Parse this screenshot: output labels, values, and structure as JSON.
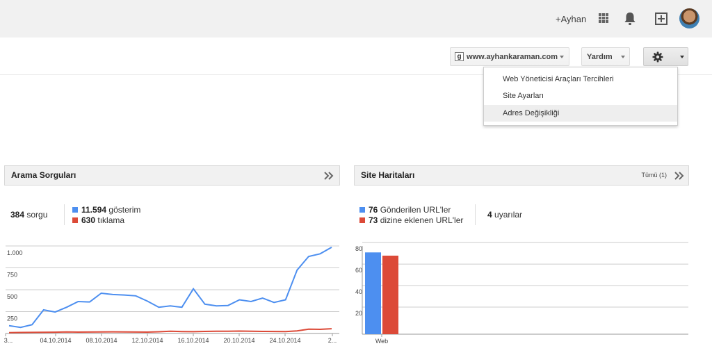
{
  "topbar": {
    "user_name": "+Ayhan"
  },
  "subbar": {
    "site_selector": "www.ayhankaraman.com",
    "site_icon_letter": "g",
    "help_label": "Yardım"
  },
  "settings_menu": {
    "items": [
      {
        "label": "Web Yöneticisi Araçları Tercihleri"
      },
      {
        "label": "Site Ayarları"
      },
      {
        "label": "Adres Değişikliği"
      }
    ]
  },
  "search_queries": {
    "title": "Arama Sorguları",
    "queries_count": "384",
    "queries_label": "sorgu",
    "impressions_count": "11.594",
    "impressions_label": "gösterim",
    "clicks_count": "630",
    "clicks_label": "tıklama"
  },
  "sitemaps": {
    "title": "Site Haritaları",
    "all_link": "Tümü (1)",
    "submitted_count": "76",
    "submitted_label": "Gönderilen URL'ler",
    "indexed_count": "73",
    "indexed_label": "dizine eklenen URL'ler",
    "warnings_count": "4",
    "warnings_label": "uyarılar"
  },
  "colors": {
    "blue": "#4d8ff0",
    "red": "#dc4a38"
  },
  "chart_data": [
    {
      "type": "line",
      "x_tick_labels": [
        "3...",
        "04.10.2014",
        "08.10.2014",
        "12.10.2014",
        "16.10.2014",
        "20.10.2014",
        "24.10.2014",
        "2..."
      ],
      "y_tick_labels": [
        "1.000",
        "750",
        "500",
        "250"
      ],
      "ylim": [
        0,
        1000
      ],
      "grid": true,
      "series": [
        {
          "name": "gösterim",
          "color": "#4d8ff0",
          "values": [
            90,
            70,
            100,
            270,
            245,
            300,
            365,
            360,
            460,
            445,
            440,
            430,
            370,
            300,
            315,
            300,
            510,
            335,
            315,
            320,
            385,
            365,
            405,
            355,
            385,
            725,
            880,
            910,
            985
          ]
        },
        {
          "name": "tıklama",
          "color": "#dc4a38",
          "values": [
            10,
            12,
            13,
            14,
            15,
            18,
            16,
            17,
            18,
            19,
            18,
            17,
            16,
            20,
            25,
            22,
            21,
            24,
            26,
            25,
            28,
            26,
            24,
            23,
            22,
            30,
            50,
            48,
            55
          ]
        }
      ]
    },
    {
      "type": "bar",
      "categories": [
        "Web"
      ],
      "y_tick_labels": [
        "80",
        "60",
        "40",
        "20"
      ],
      "ylim": [
        0,
        82
      ],
      "grid": true,
      "series": [
        {
          "name": "Gönderilen URL'ler",
          "color": "#4d8ff0",
          "values": [
            76
          ]
        },
        {
          "name": "dizine eklenen URL'ler",
          "color": "#dc4a38",
          "values": [
            73
          ]
        }
      ]
    }
  ]
}
